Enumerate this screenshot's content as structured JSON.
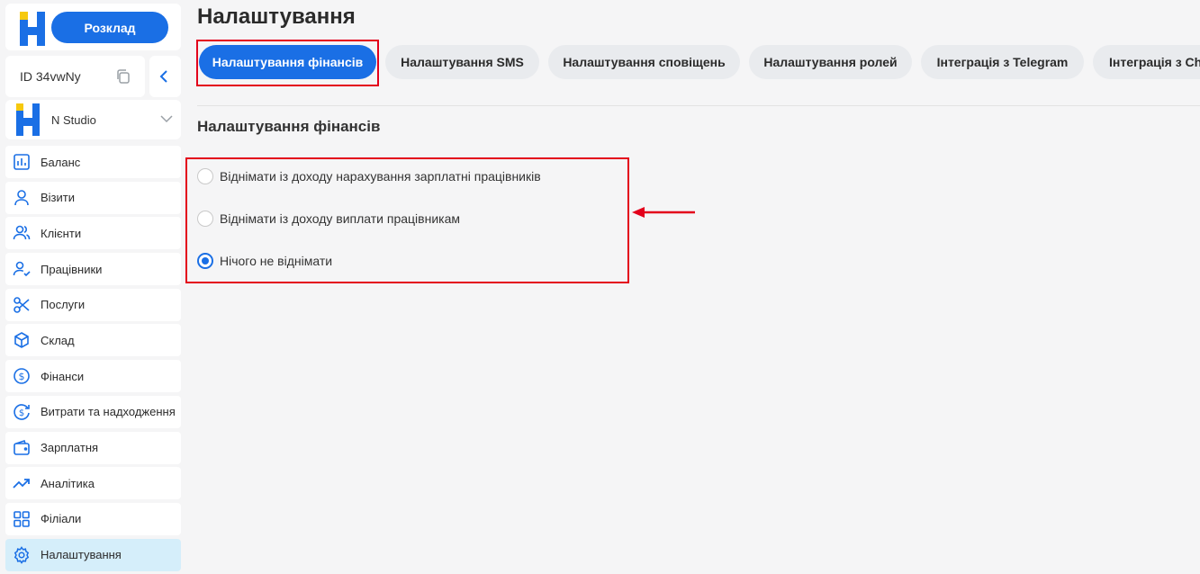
{
  "sidebar": {
    "schedule_label": "Розклад",
    "account_id": "ID 34vwNy",
    "studio_name": "N Studio",
    "items": [
      {
        "label": "Баланс",
        "icon": "chart-bars-icon"
      },
      {
        "label": "Візити",
        "icon": "user-icon"
      },
      {
        "label": "Клієнти",
        "icon": "users-icon"
      },
      {
        "label": "Працівники",
        "icon": "user-check-icon"
      },
      {
        "label": "Послуги",
        "icon": "scissors-icon"
      },
      {
        "label": "Склад",
        "icon": "box-icon"
      },
      {
        "label": "Фінанси",
        "icon": "dollar-circle-icon"
      },
      {
        "label": "Витрати та надходження",
        "icon": "dollar-refresh-icon"
      },
      {
        "label": "Зарплатня",
        "icon": "wallet-icon"
      },
      {
        "label": "Аналітика",
        "icon": "trend-up-icon"
      },
      {
        "label": "Філіали",
        "icon": "grid-icon"
      },
      {
        "label": "Налаштування",
        "icon": "gear-icon",
        "active": true
      }
    ]
  },
  "page": {
    "title": "Налаштування",
    "tabs": [
      {
        "label": "Налаштування фінансів",
        "active": true
      },
      {
        "label": "Налаштування SMS"
      },
      {
        "label": "Налаштування сповіщень"
      },
      {
        "label": "Налаштування ролей"
      },
      {
        "label": "Інтеграція з Telegram"
      },
      {
        "label": "Інтеграція з Ch"
      }
    ],
    "section_title": "Налаштування фінансів",
    "options": [
      {
        "label": "Віднімати із доходу нарахування зарплатні працівників",
        "checked": false
      },
      {
        "label": "Віднімати із доходу виплати працівникам",
        "checked": false
      },
      {
        "label": "Нічого не віднімати",
        "checked": true
      }
    ]
  },
  "colors": {
    "accent": "#1a6fe5",
    "highlight": "#e3001b",
    "active_nav_bg": "#d5eefa",
    "tab_bg": "#e9ebee",
    "page_bg": "#f5f5f6"
  }
}
